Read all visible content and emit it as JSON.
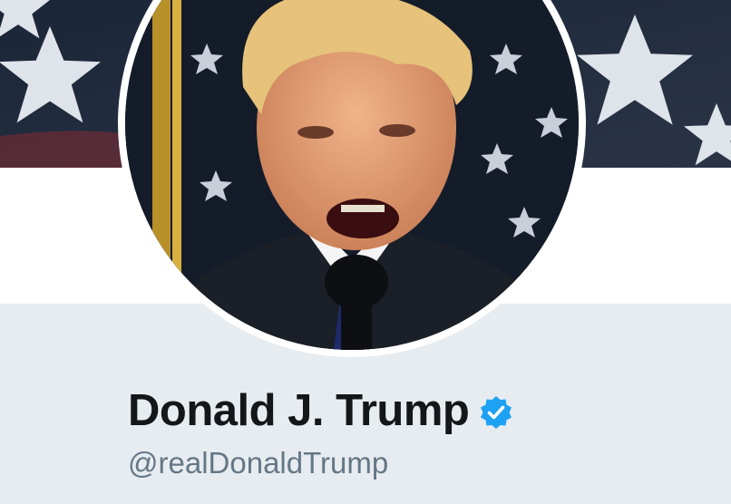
{
  "profile": {
    "name": "Donald J. Trump",
    "handle": "@realDonaldTrump",
    "verified": true
  },
  "banner": {
    "icon": "flag-banner-image"
  },
  "avatar": {
    "icon": "profile-photo"
  },
  "colors": {
    "verified_badge": "#1da1f2",
    "name_text": "#14171a",
    "handle_text": "#657786",
    "info_background": "#e6ecf0"
  }
}
